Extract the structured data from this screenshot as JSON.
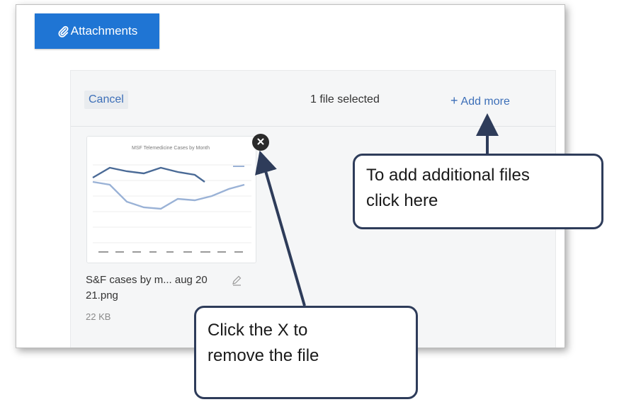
{
  "attachments_button": {
    "label": "Attachments",
    "icon": "paperclip-icon",
    "color": "#1f75d4"
  },
  "panel": {
    "cancel_label": "Cancel",
    "selected_text": "1 file selected",
    "add_more_label": "Add more",
    "add_more_icon": "plus-icon"
  },
  "file": {
    "thumbnail_title": "MSF Telemedicine Cases by Month",
    "name_line1": "S&F cases by m... aug 20",
    "name_line2": "21.png",
    "size": "22 KB",
    "remove_icon": "close-icon",
    "edit_icon": "pencil-icon"
  },
  "callouts": {
    "add_more_line1": "To add additional files",
    "add_more_line2": "click here",
    "remove_line1": "Click the X to",
    "remove_line2": "remove the file"
  },
  "colors": {
    "accent": "#3d6fb8",
    "callout_border": "#2e3c5a"
  }
}
